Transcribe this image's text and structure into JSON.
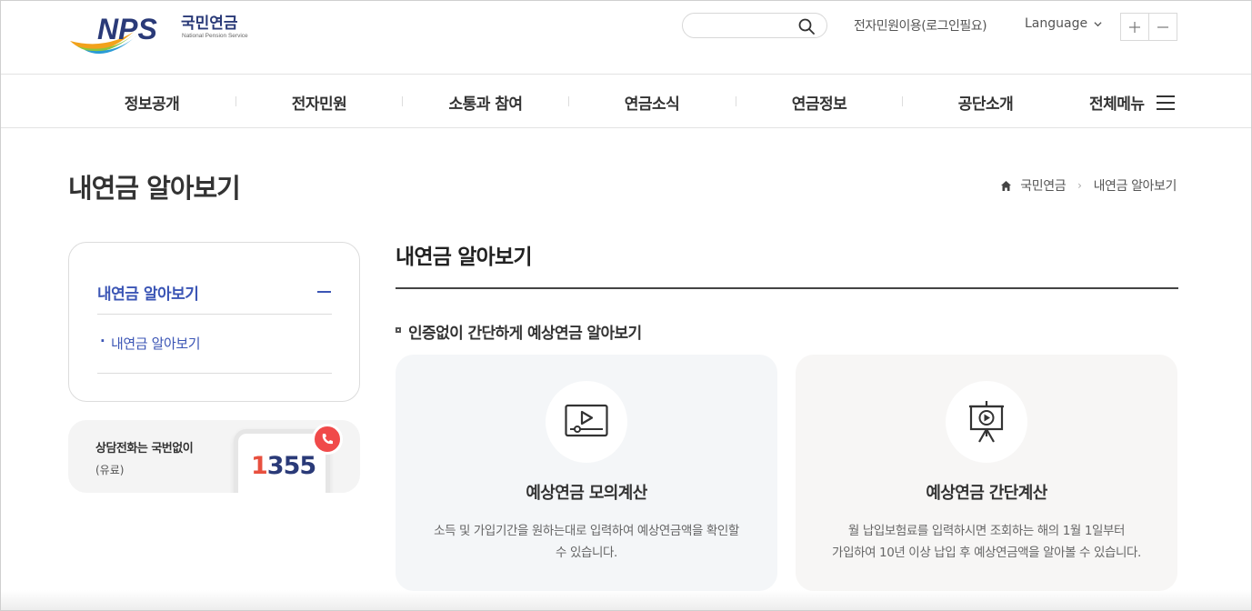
{
  "header": {
    "logo": {
      "text": "NPS",
      "korean": "국민연금",
      "english": "National Pension Service"
    },
    "search": {
      "placeholder": ""
    },
    "util_link": "전자민원이용(로그인필요)",
    "language_label": "Language",
    "zoom_in": "+",
    "zoom_out": "−"
  },
  "gnb": {
    "items": [
      "정보공개",
      "전자민원",
      "소통과 참여",
      "연금소식",
      "연금정보",
      "공단소개"
    ],
    "all_menu": "전체메뉴"
  },
  "page": {
    "title": "내연금 알아보기",
    "breadcrumb": [
      "국민연금",
      "내연금 알아보기"
    ]
  },
  "lnb": {
    "heading": "내연금 알아보기",
    "sub_item": "내연금 알아보기"
  },
  "call_banner": {
    "title": "상담전화는 국번없이",
    "note": "(유료)",
    "number_first": "1",
    "number_rest": "355"
  },
  "content": {
    "title": "내연금 알아보기",
    "section_title": "인증없이 간단하게 예상연금 알아보기",
    "cards": [
      {
        "title": "예상연금 모의계산",
        "desc_line1": "소득 및 가입기간을 원하는대로 입력하여 예상연금액을 확인할",
        "desc_line2": "수 있습니다.",
        "icon": "video-player-icon"
      },
      {
        "title": "예상연금 간단계산",
        "desc_line1": "월 납입보험료를 입력하시면 조회하는 해의 1월 1일부터",
        "desc_line2": "가입하여 10년 이상 납입 후 예상연금액을 알아볼 수 있습니다.",
        "icon": "presentation-play-icon"
      }
    ]
  },
  "colors": {
    "accent_blue": "#3b55b5",
    "logo_navy": "#2a3a78",
    "badge_red": "#f04a4a"
  }
}
